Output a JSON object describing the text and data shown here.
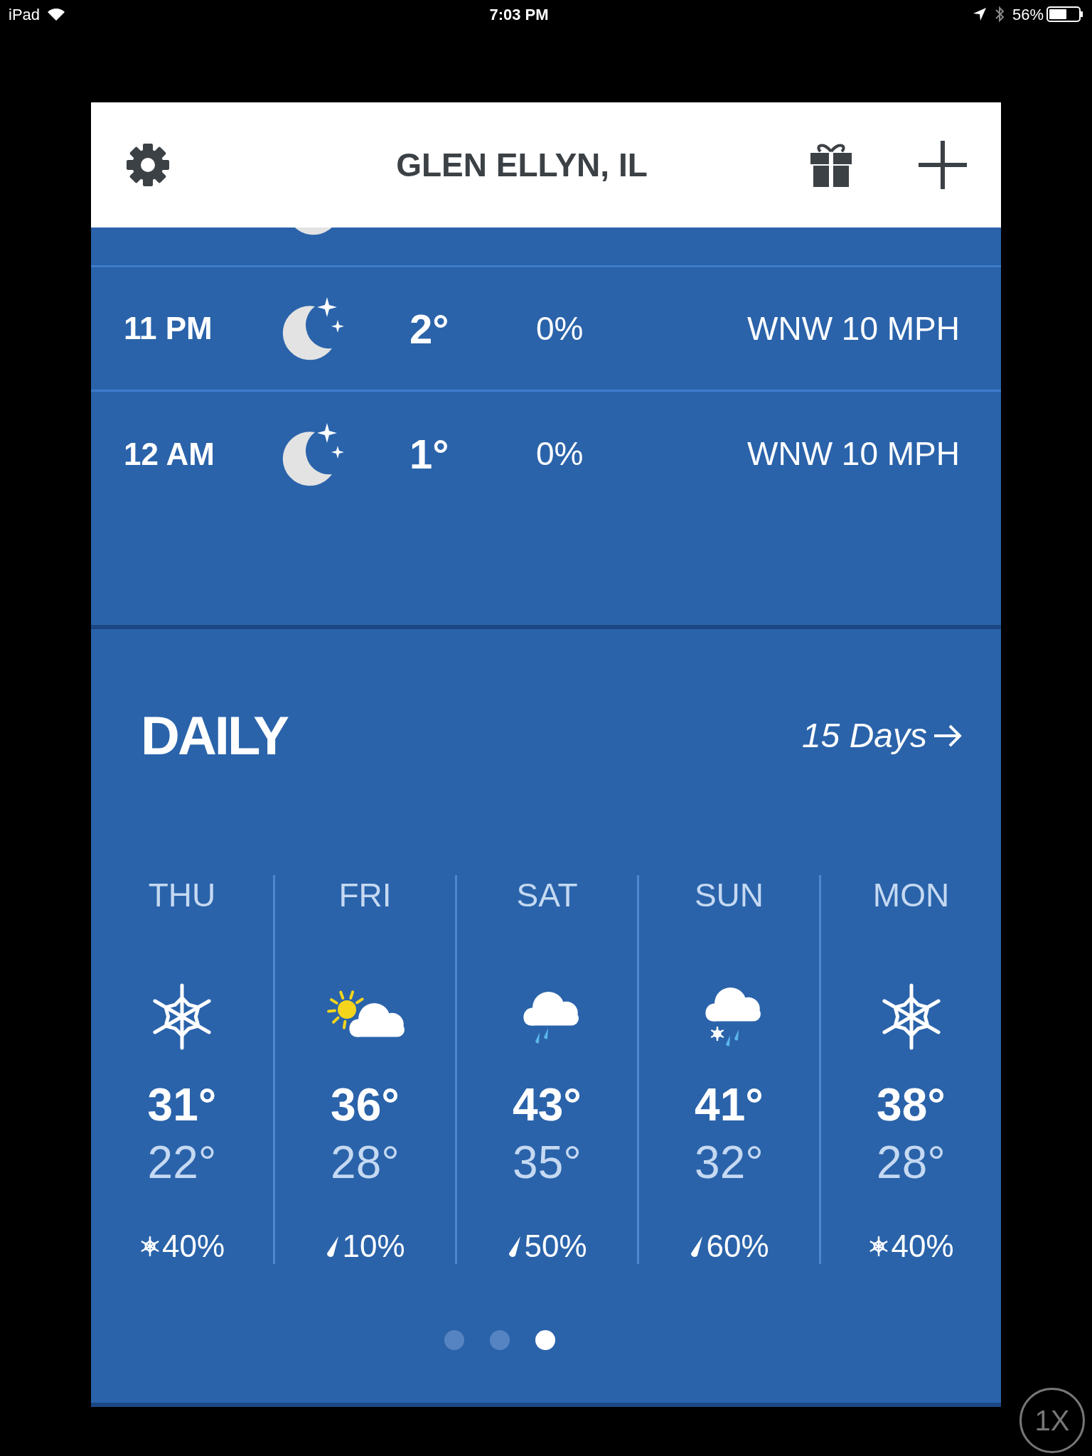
{
  "status_bar": {
    "device": "iPad",
    "time": "7:03 PM",
    "battery": "56%"
  },
  "header": {
    "title": "GLEN ELLYN, IL"
  },
  "hourly": [
    {
      "time": "11 PM",
      "kind": "moon",
      "temp": "2°",
      "precip": "0%",
      "wind": "WNW 10 MPH"
    },
    {
      "time": "12 AM",
      "kind": "moon",
      "temp": "1°",
      "precip": "0%",
      "wind": "WNW 10 MPH"
    }
  ],
  "daily": {
    "title": "DAILY",
    "link": "15 Days",
    "days": [
      {
        "day": "THU",
        "kind": "snow",
        "high": "31°",
        "low": "22°",
        "precip": {
          "kind": "snow",
          "text": "40%"
        }
      },
      {
        "day": "FRI",
        "kind": "partly-sunny",
        "high": "36°",
        "low": "28°",
        "precip": {
          "kind": "rain",
          "text": "10%"
        }
      },
      {
        "day": "SAT",
        "kind": "rain",
        "high": "43°",
        "low": "35°",
        "precip": {
          "kind": "rain",
          "text": "50%"
        }
      },
      {
        "day": "SUN",
        "kind": "rain-snow",
        "high": "41°",
        "low": "32°",
        "precip": {
          "kind": "rain",
          "text": "60%"
        }
      },
      {
        "day": "MON",
        "kind": "snow",
        "high": "38°",
        "low": "28°",
        "precip": {
          "kind": "snow",
          "text": "40%"
        }
      }
    ]
  },
  "pager": [
    {
      "selected": false
    },
    {
      "selected": false
    },
    {
      "selected": true
    }
  ],
  "zoom_button": "1X"
}
